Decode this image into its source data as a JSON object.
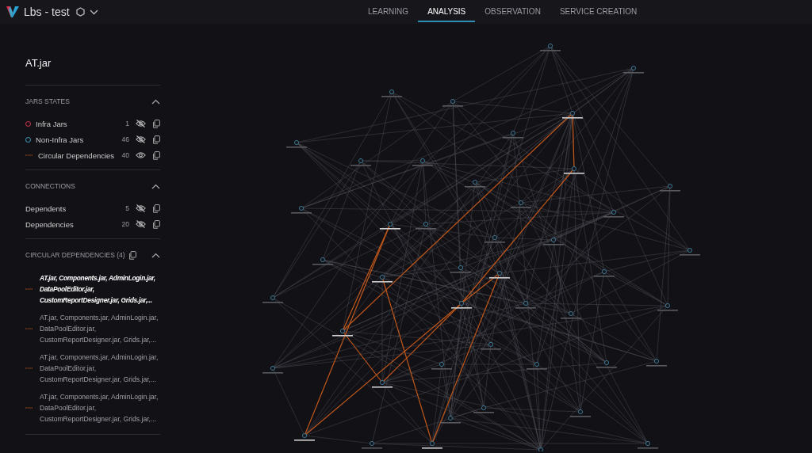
{
  "header": {
    "project": "Lbs - test",
    "tabs": [
      {
        "label": "LEARNING",
        "selected": false
      },
      {
        "label": "ANALYSIS",
        "selected": true
      },
      {
        "label": "OBSERVATION",
        "selected": false
      },
      {
        "label": "SERVICE CREATION",
        "selected": false
      }
    ]
  },
  "sidebar": {
    "title": "AT.jar",
    "jars_states": {
      "heading": "JARS STATES",
      "expanded": true,
      "items": [
        {
          "kind": "infra",
          "label": "Infra Jars",
          "count": "1",
          "visible": false
        },
        {
          "kind": "non_infra",
          "label": "Non-Infra Jars",
          "count": "46",
          "visible": false
        },
        {
          "kind": "circular",
          "label": "Circular Dependencies",
          "count": "40",
          "visible": true
        }
      ]
    },
    "connections": {
      "heading": "CONNECTIONS",
      "expanded": true,
      "items": [
        {
          "label": "Dependents",
          "count": "5",
          "visible": false
        },
        {
          "label": "Dependencies",
          "count": "20",
          "visible": false
        }
      ]
    },
    "circular_dependencies": {
      "heading": "CIRCULAR DEPENDENCIES (4)",
      "expanded": true,
      "items": [
        {
          "text": "AT.jar, Components.jar, AdminLogin.jar, DataPoolEditor.jar, CustomReportDesigner.jar, Grids.jar,...",
          "selected": true
        },
        {
          "text": "AT.jar, Components.jar, AdminLogin.jar, DataPoolEditor.jar, CustomReportDesigner.jar, Grids.jar,...",
          "selected": false
        },
        {
          "text": "AT.jar, Components.jar, AdminLogin.jar, DataPoolEditor.jar, CustomReportDesigner.jar, Grids.jar,...",
          "selected": false
        },
        {
          "text": "AT.jar, Components.jar, AdminLogin.jar, DataPoolEditor.jar, CustomReportDesigner.jar, Grids.jar,...",
          "selected": false
        }
      ]
    }
  }
}
